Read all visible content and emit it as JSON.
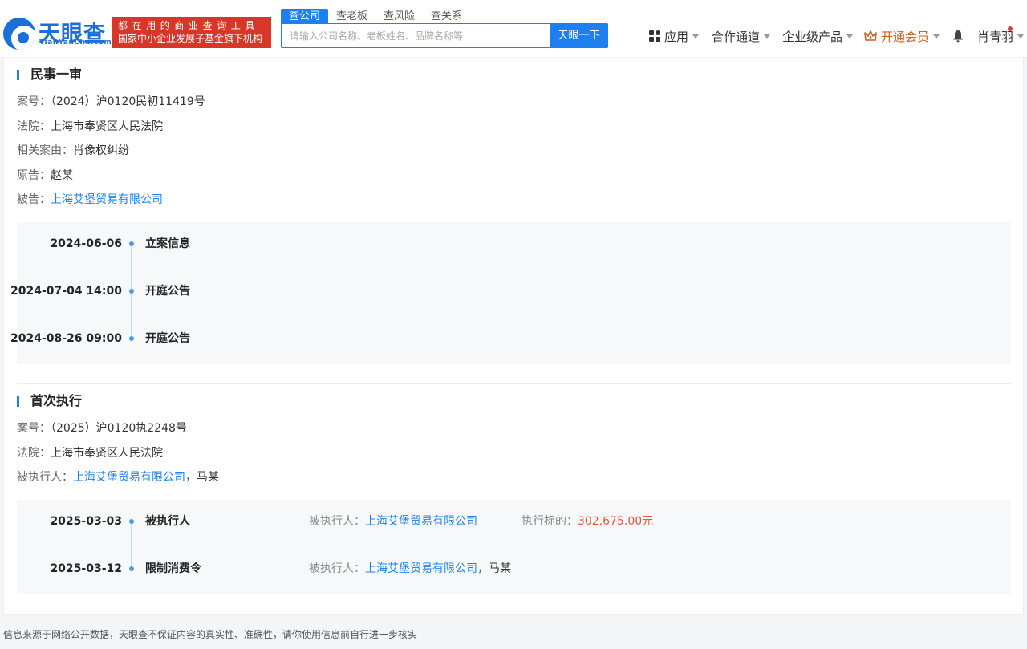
{
  "header": {
    "logo_text": "天眼查",
    "logo_sub": "TianYanCha.com",
    "slogan_line1": "都在用的商业查询工具",
    "slogan_line2": "国家中小企业发展子基金旗下机构",
    "search_tabs": [
      {
        "label": "查公司",
        "active": true
      },
      {
        "label": "查老板",
        "active": false
      },
      {
        "label": "查风险",
        "active": false
      },
      {
        "label": "查关系",
        "active": false
      }
    ],
    "search_placeholder": "请输入公司名称、老板姓名、品牌名称等",
    "search_button": "天眼一下",
    "nav": {
      "apps": "应用",
      "partner": "合作通道",
      "enterprise": "企业级产品",
      "vip": "开通会员",
      "user": "肖青羽"
    }
  },
  "section1": {
    "title": "民事一审",
    "case_no_label": "案号：",
    "case_no": "（2024）沪0120民初11419号",
    "court_label": "法院：",
    "court": "上海市奉贤区人民法院",
    "cause_label": "相关案由：",
    "cause": "肖像权纠纷",
    "plaintiff_label": "原告：",
    "plaintiff": "赵某",
    "defendant_label": "被告：",
    "defendant": "上海艾堡贸易有限公司",
    "timeline": [
      {
        "date": "2024-06-06",
        "title": "立案信息"
      },
      {
        "date": "2024-07-04 14:00",
        "title": "开庭公告"
      },
      {
        "date": "2024-08-26 09:00",
        "title": "开庭公告"
      }
    ]
  },
  "section2": {
    "title": "首次执行",
    "case_no_label": "案号：",
    "case_no": "（2025）沪0120执2248号",
    "court_label": "法院：",
    "court": "上海市奉贤区人民法院",
    "executed_label": "被执行人：",
    "executed_company": "上海艾堡贸易有限公司",
    "executed_sep": "，",
    "executed_person": "马某",
    "timeline": [
      {
        "date": "2025-03-03",
        "title": "被执行人",
        "detail_label": "被执行人：",
        "detail_company": "上海艾堡贸易有限公司",
        "amount_label": "执行标的：",
        "amount": "302,675.00元"
      },
      {
        "date": "2025-03-12",
        "title": "限制消费令",
        "detail_label": "被执行人：",
        "detail_company": "上海艾堡贸易有限公司",
        "detail_sep": "，",
        "detail_person": "马某"
      }
    ]
  },
  "footer": "信息来源于网络公开数据，天眼查不保证内容的真实性、准确性，请你使用信息前自行进一步核实",
  "colors": {
    "brand": "#1e80f0",
    "slogan_bg": "#d9362a",
    "vip": "#c7611d",
    "amount": "#e8553d"
  }
}
